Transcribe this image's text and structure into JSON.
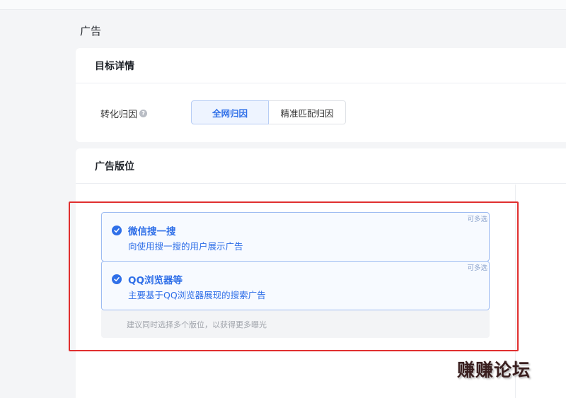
{
  "page": {
    "title": "广告"
  },
  "target_card": {
    "header": "目标详情",
    "attribution": {
      "label": "转化归因",
      "help_icon": "question-circle-icon",
      "options": [
        "全网归因",
        "精准匹配归因"
      ],
      "selected": "全网归因"
    }
  },
  "placement_card": {
    "header": "广告版位",
    "options": [
      {
        "badge": "可多选",
        "title": "微信搜一搜",
        "desc": "向使用搜一搜的用户展示广告",
        "checked": true
      },
      {
        "badge": "可多选",
        "title": "QQ浏览器等",
        "desc": "主要基于QQ浏览器展现的搜索广告",
        "checked": true
      }
    ],
    "hint": "建议同时选择多个版位，以获得更多曝光"
  },
  "colors": {
    "accent": "#2f6fe8",
    "highlight": "#e02f2f"
  },
  "watermark": "赚赚论坛"
}
